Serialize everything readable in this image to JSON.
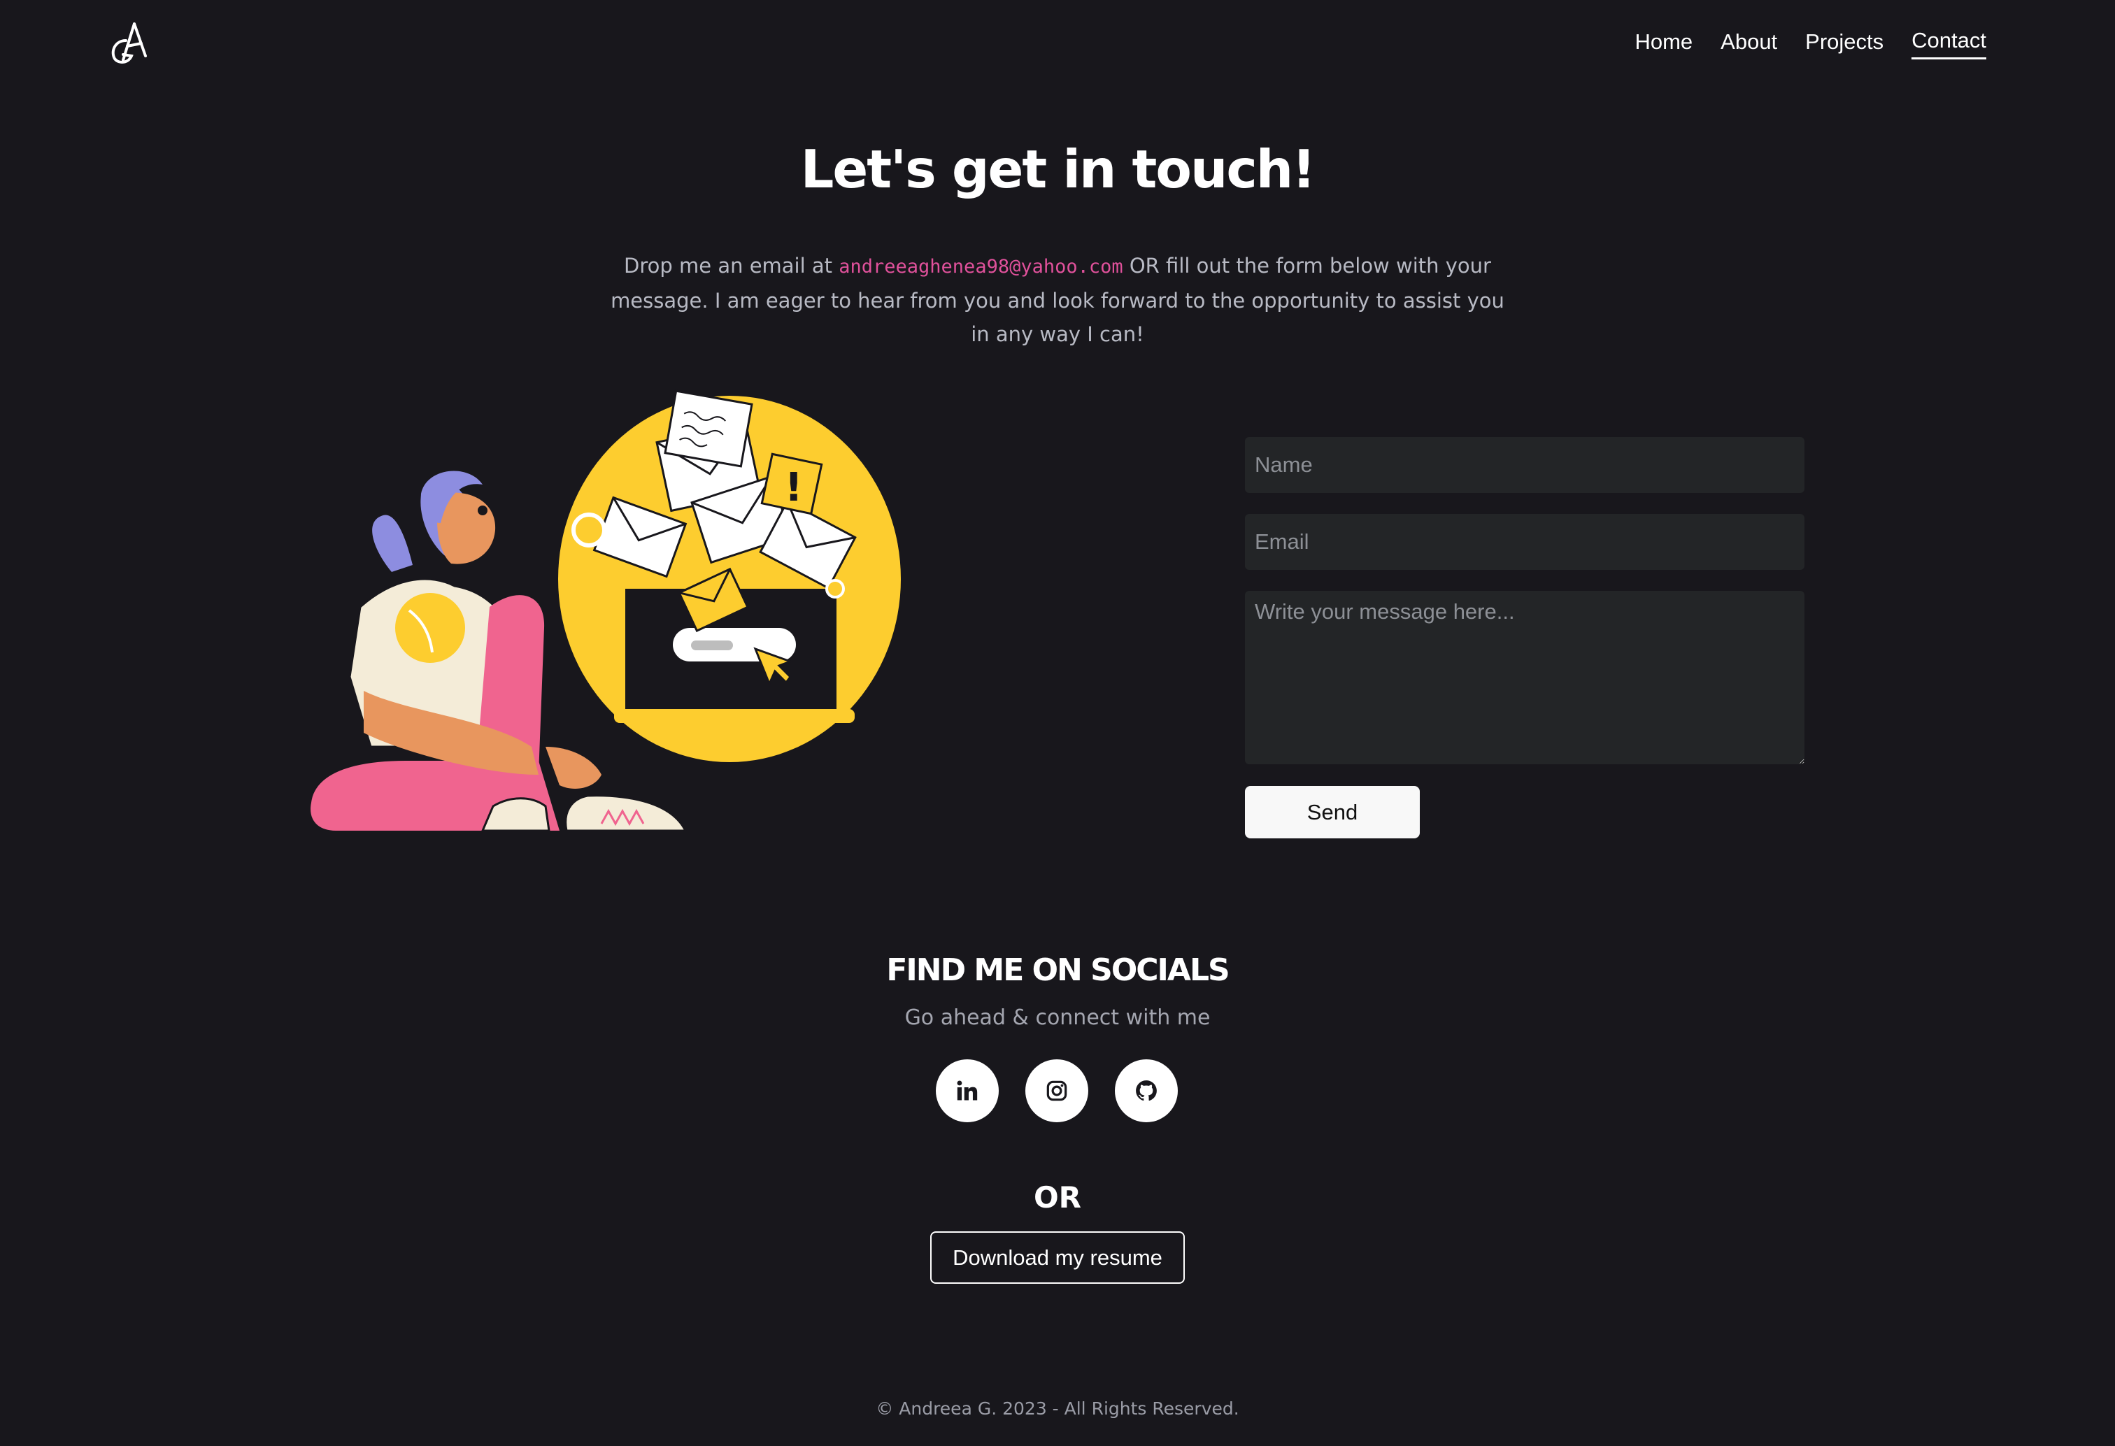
{
  "nav": {
    "logo_icon": "ga-monogram-icon",
    "links": [
      "Home",
      "About",
      "Projects",
      "Contact"
    ],
    "active": "Contact"
  },
  "hero": {
    "title": "Let's get in touch!",
    "intro_before": "Drop me an email at ",
    "email": "andreeaghenea98@yahoo.com",
    "intro_after": " OR fill out the form below with your message. I am eager to hear from you and look forward to the opportunity to assist you in any way I can!"
  },
  "form": {
    "name_placeholder": "Name",
    "email_placeholder": "Email",
    "message_placeholder": "Write your message here...",
    "send_label": "Send"
  },
  "socials": {
    "title": "FIND ME ON SOCIALS",
    "subtitle": "Go ahead & connect with me",
    "icons": [
      "linkedin-icon",
      "instagram-icon",
      "github-icon"
    ]
  },
  "resume": {
    "or_label": "OR",
    "button_label": "Download my resume"
  },
  "footer": {
    "text": "© Andreea G. 2023 - All Rights Reserved."
  },
  "colors": {
    "background": "#18171c",
    "accent_email": "#e0519b",
    "illustration_yellow": "#fdcd2f",
    "illustration_pink": "#f0648f",
    "input_bg": "#232527"
  }
}
